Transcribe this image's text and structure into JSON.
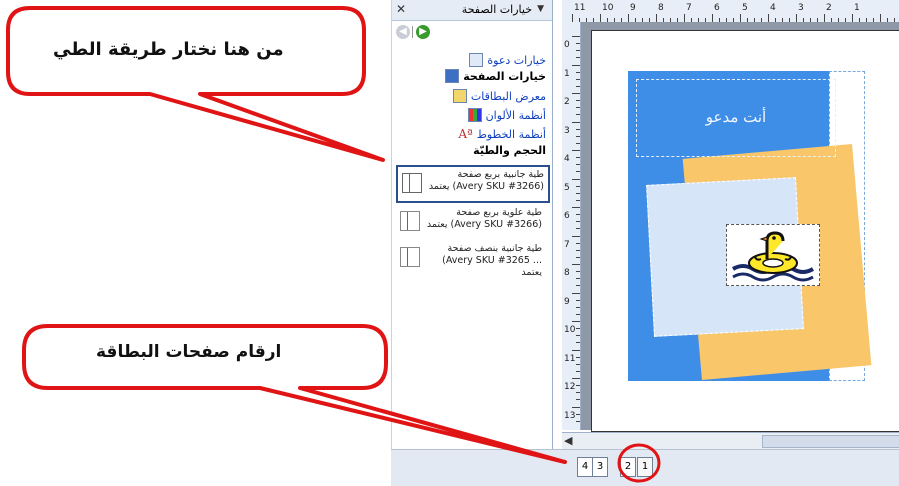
{
  "callouts": [
    {
      "text": "من هنا نختار طريقة الطي"
    },
    {
      "text": "ارقام صفحات البطاقة"
    }
  ],
  "task_pane": {
    "title": "خيارات الصفحة",
    "links": [
      {
        "label": "خيارات دعوة",
        "active": false
      },
      {
        "label": "خيارات الصفحة",
        "active": true
      },
      {
        "label": "معرض البطاقات",
        "active": false
      },
      {
        "label": "أنظمة الألوان",
        "active": false
      },
      {
        "label": "أنظمة الخطوط",
        "active": false
      }
    ],
    "section_label": "الحجم والطيّة",
    "fold_options": [
      {
        "line1": "طية جانبية بربع صفحة",
        "line2": "(Avery SKU #3266) يعتمد",
        "selected": true
      },
      {
        "line1": "طية علوية بربع صفحة",
        "line2": "(Avery SKU #3266) يعتمد",
        "selected": false
      },
      {
        "line1": "طية جانبية بنصف صفحة",
        "line2": "... Avery SKU #3265) يعتمد",
        "selected": false
      }
    ]
  },
  "ruler": {
    "top_numbers": [
      "11",
      "10",
      "9",
      "8",
      "7",
      "6",
      "5",
      "4",
      "3",
      "2",
      "1"
    ],
    "left_numbers": [
      "0",
      "1",
      "2",
      "3",
      "4",
      "5",
      "6",
      "7",
      "8",
      "9",
      "10",
      "11",
      "12",
      "13"
    ]
  },
  "card": {
    "title_text": "أنت مدعو",
    "image_icon": "duck-on-swim-ring-image"
  },
  "page_tabs": [
    "4",
    "3",
    "2",
    "1"
  ],
  "colors": {
    "blue_panel": "#3e8ee8",
    "orange_panel": "#fac66a",
    "light_panel": "#d6e6f8",
    "callout_border": "#e01414",
    "highlight_circle": "#e01414"
  }
}
